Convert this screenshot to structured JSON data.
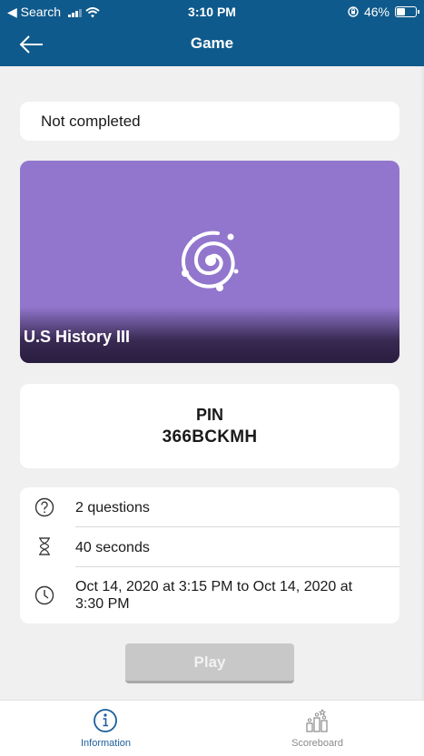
{
  "status_bar": {
    "back_app": "◀ Search",
    "time": "3:10 PM",
    "battery_percent": "46%",
    "battery_level": 0.46
  },
  "nav": {
    "title": "Game"
  },
  "completion_status": "Not completed",
  "game": {
    "title": "U.S History III",
    "banner_color": "#9276cd"
  },
  "pin": {
    "label": "PIN",
    "value": "366BCKMH"
  },
  "details": [
    {
      "icon": "question-circle-icon",
      "text": "2 questions"
    },
    {
      "icon": "hourglass-icon",
      "text": "40 seconds"
    },
    {
      "icon": "clock-icon",
      "text": "Oct 14, 2020 at 3:15 PM to Oct 14, 2020 at 3:30 PM"
    }
  ],
  "play_label": "Play",
  "tabs": [
    {
      "label": "Information",
      "icon": "info-icon",
      "active": true
    },
    {
      "label": "Scoreboard",
      "icon": "scoreboard-icon",
      "active": false
    }
  ],
  "colors": {
    "header": "#0f5a8c",
    "active_tab": "#1b5e9b",
    "play_disabled": "#c8c8c8"
  }
}
